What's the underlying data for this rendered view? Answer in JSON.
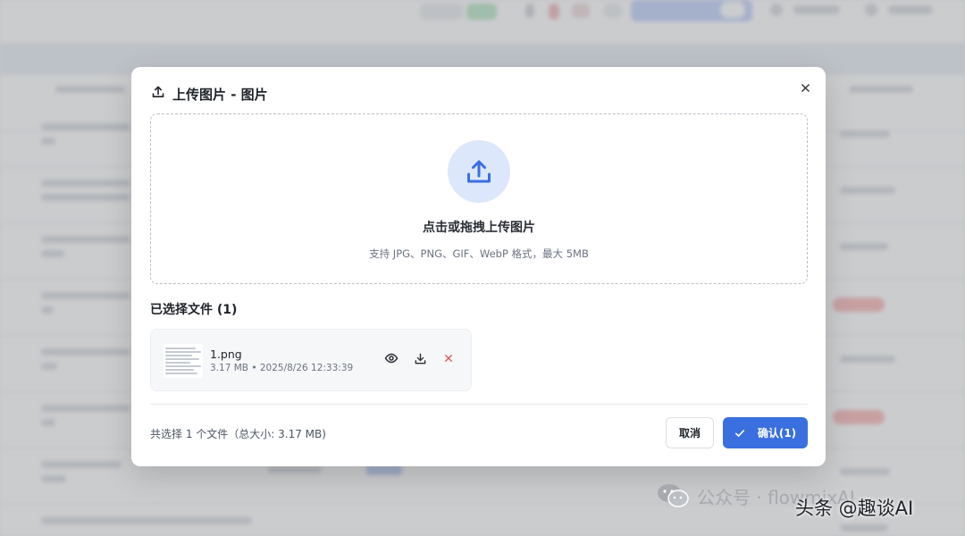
{
  "dialog": {
    "title": "上传图片 - 图片",
    "dropzone": {
      "title": "点击或拖拽上传图片",
      "hint": "支持 JPG、PNG、GIF、WebP 格式，最大 5MB"
    },
    "selected_heading": "已选择文件 (1)",
    "files": [
      {
        "name": "1.png",
        "meta": "3.17 MB • 2025/8/26 12:33:39"
      }
    ],
    "footer": {
      "summary": "共选择 1 个文件（总大小: 3.17 MB)",
      "cancel_label": "取消",
      "confirm_label": "确认(1)"
    }
  },
  "watermark": {
    "account": "公众号 · flowmixAI",
    "author": "头条 @趣谈AI"
  },
  "icons": {
    "title": "upload-icon",
    "close": "close-icon",
    "dropzone": "upload-tray-icon",
    "preview": "eye-icon",
    "download": "download-icon",
    "remove": "remove-icon",
    "confirm": "check-icon",
    "watermark": "wechat-icon"
  },
  "colors": {
    "primary": "#3a6fe0",
    "upload_circle": "#dde7fb",
    "remove": "#d9534f"
  }
}
